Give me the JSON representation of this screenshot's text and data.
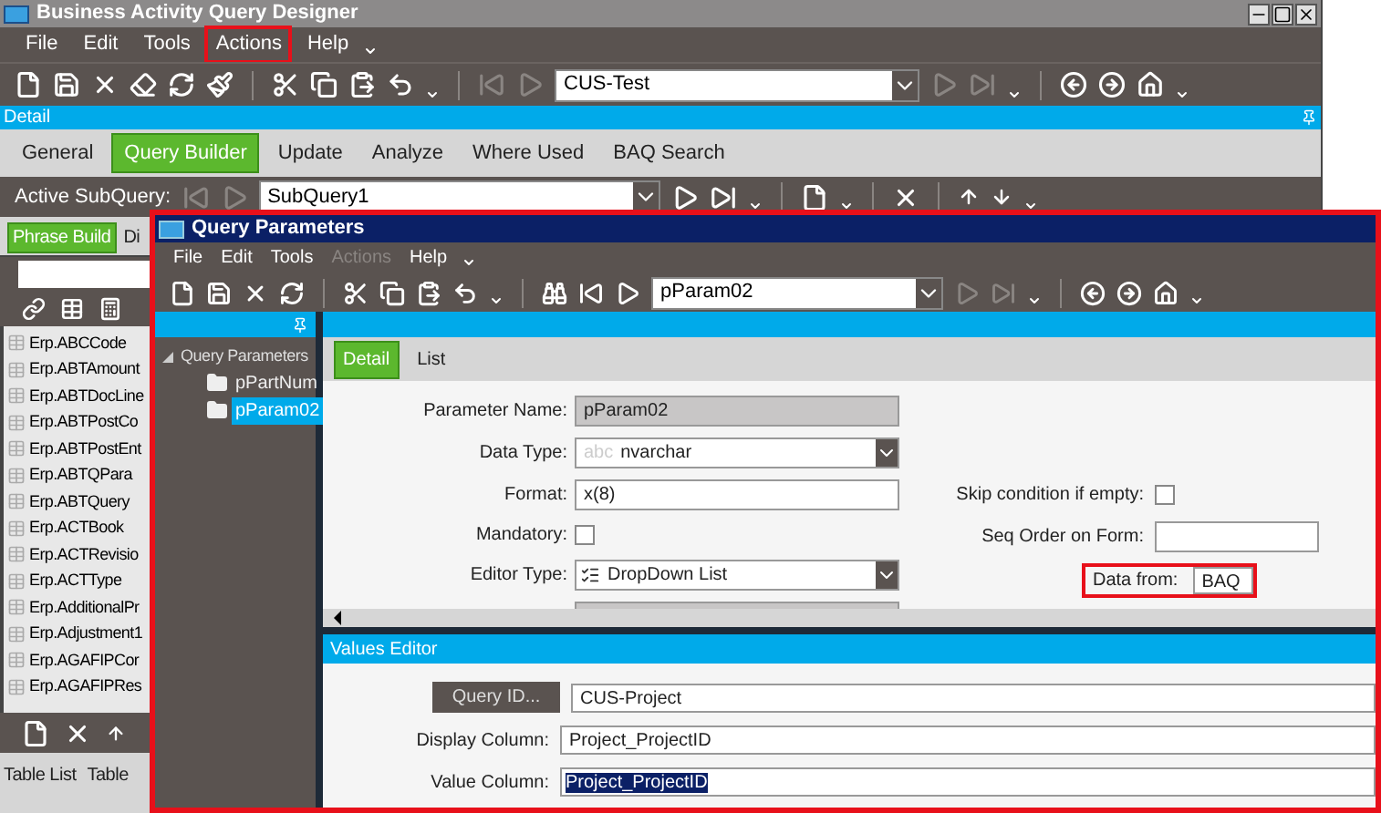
{
  "window": {
    "title": "Business Activity Query Designer"
  },
  "menu": [
    {
      "label": "File",
      "disabled": false,
      "highlighted": false
    },
    {
      "label": "Edit",
      "disabled": false,
      "highlighted": false
    },
    {
      "label": "Tools",
      "disabled": false,
      "highlighted": false
    },
    {
      "label": "Actions",
      "disabled": false,
      "highlighted": true
    },
    {
      "label": "Help",
      "disabled": false,
      "highlighted": false
    }
  ],
  "toolbar": {
    "record": "CUS-Test"
  },
  "detail_bar": {
    "title": "Detail"
  },
  "tabs": [
    {
      "label": "General",
      "selected": false
    },
    {
      "label": "Query Builder",
      "selected": true
    },
    {
      "label": "Update",
      "selected": false
    },
    {
      "label": "Analyze",
      "selected": false
    },
    {
      "label": "Where Used",
      "selected": false
    },
    {
      "label": "BAQ Search",
      "selected": false
    }
  ],
  "subquery": {
    "label": "Active SubQuery:",
    "value": "SubQuery1"
  },
  "left_panel": {
    "tabs": [
      {
        "label": "Phrase Build",
        "selected": true
      },
      {
        "label": "Di",
        "selected": false
      }
    ],
    "tables": [
      "Erp.ABCCode",
      "Erp.ABTAmount",
      "Erp.ABTDocLine",
      "Erp.ABTPostCo",
      "Erp.ABTPostEnt",
      "Erp.ABTQPara",
      "Erp.ABTQuery",
      "Erp.ACTBook",
      "Erp.ACTRevisio",
      "Erp.ACTType",
      "Erp.AdditionalPr",
      "Erp.Adjustment1",
      "Erp.AGAFIPCor",
      "Erp.AGAFIPRes"
    ],
    "bottom_tabs": [
      "Table List",
      "Table"
    ]
  },
  "dialog": {
    "title": "Query Parameters",
    "highlighted": true,
    "menu": [
      {
        "label": "File",
        "disabled": false
      },
      {
        "label": "Edit",
        "disabled": false
      },
      {
        "label": "Tools",
        "disabled": false
      },
      {
        "label": "Actions",
        "disabled": true
      },
      {
        "label": "Help",
        "disabled": false
      }
    ],
    "record": "pParam02",
    "tree": {
      "label": "Query Parameters",
      "expanded": true,
      "children": [
        {
          "label": "pPartNum",
          "selected": false
        },
        {
          "label": "pParam02",
          "selected": true
        }
      ]
    },
    "tabs": [
      {
        "label": "Detail",
        "selected": true
      },
      {
        "label": "List",
        "selected": false
      }
    ],
    "form": {
      "parameter_name": {
        "label": "Parameter Name:",
        "value": "pParam02"
      },
      "data_type": {
        "label": "Data Type:",
        "hint": "abc",
        "value": "nvarchar"
      },
      "format": {
        "label": "Format:",
        "value": "x(8)"
      },
      "mandatory": {
        "label": "Mandatory:",
        "checked": false
      },
      "editor_type": {
        "label": "Editor Type:",
        "value": "DropDown List"
      },
      "skip_condition": {
        "label": "Skip condition if empty:",
        "checked": false
      },
      "seq_order": {
        "label": "Seq Order on Form:"
      },
      "data_from": {
        "label": "Data from:",
        "value": "BAQ",
        "highlighted": true
      }
    },
    "values_editor": {
      "title": "Values Editor",
      "query_button": "Query ID...",
      "query_id": "CUS-Project",
      "display_column": {
        "label": "Display Column:",
        "value": "Project_ProjectID"
      },
      "value_column": {
        "label": "Value Column:",
        "value": "Project_ProjectID",
        "selected": true
      }
    }
  }
}
